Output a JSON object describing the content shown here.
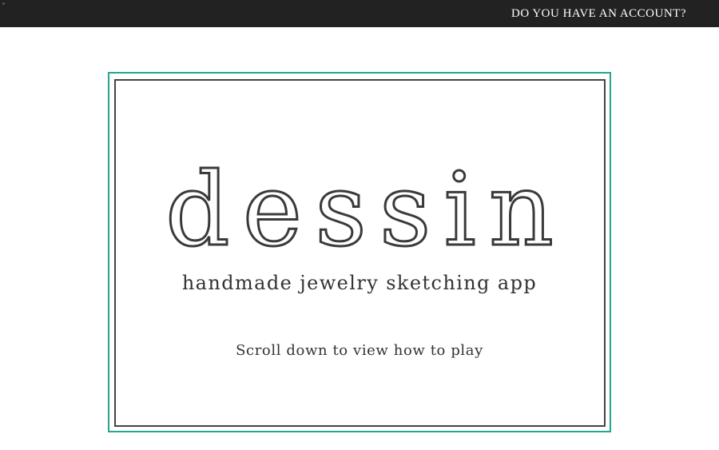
{
  "header": {
    "account_prompt": "DO YOU HAVE AN ACCOUNT?"
  },
  "hero": {
    "logo_text": "dessin",
    "tagline": "handmade jewelry sketching app",
    "scroll_hint": "Scroll down to view how to play"
  },
  "colors": {
    "topbar_bg": "#222222",
    "frame_accent": "#26a68e",
    "frame_inner": "#444444",
    "text": "#333333"
  }
}
